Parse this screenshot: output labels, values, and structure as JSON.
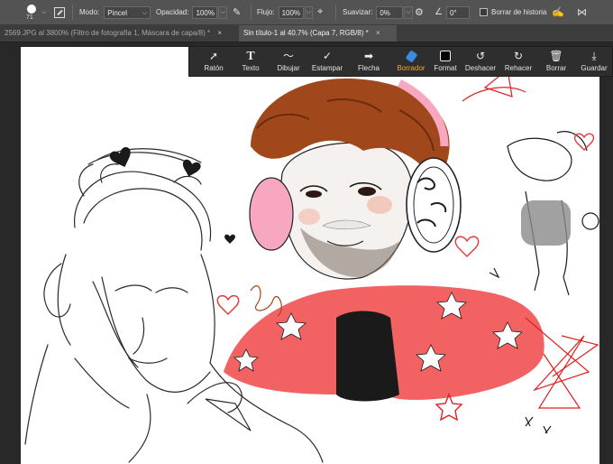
{
  "options_bar": {
    "brush_size": "71",
    "mode_label": "Modo:",
    "mode_value": "Pincel",
    "opacity_label": "Opacidad:",
    "opacity_value": "100%",
    "flow_label": "Flujo:",
    "flow_value": "100%",
    "smoothing_label": "Suavizar:",
    "smoothing_value": "0%",
    "angle_value": "0°",
    "erase_history_label": "Borrar de historia"
  },
  "tabs": [
    {
      "label": "2569.JPG al 3800% (Filtro de fotografía 1, Máscara de capa/8) *",
      "close": "×"
    },
    {
      "label": "Sin título-1 al 40.7% (Capa 7, RGB/8) *",
      "close": "×"
    }
  ],
  "toolbar": {
    "items": [
      {
        "label": "Ratón",
        "icon": "cursor-arrow-icon"
      },
      {
        "label": "Texto",
        "icon": "text-T-icon"
      },
      {
        "label": "Dibujar",
        "icon": "draw-wave-icon"
      },
      {
        "label": "Estampar",
        "icon": "stamp-check-icon"
      },
      {
        "label": "Flecha",
        "icon": "arrow-right-icon"
      },
      {
        "label": "Borrador",
        "icon": "eraser-icon"
      },
      {
        "label": "Format",
        "icon": "format-square-icon"
      },
      {
        "label": "Deshacer",
        "icon": "undo-icon"
      },
      {
        "label": "Rehacer",
        "icon": "redo-icon"
      },
      {
        "label": "Borrar",
        "icon": "trash-icon"
      },
      {
        "label": "Guardar",
        "icon": "save-download-icon"
      }
    ],
    "selected": "Borrador",
    "accent": "#f5a623"
  },
  "colors": {
    "canvas": "#ffffff",
    "app_bg": "#282828",
    "options_bg": "#535353",
    "shirt_red": "#f26262",
    "hair_brown": "#a0481c",
    "headphone_pink": "#f7a8c0"
  }
}
